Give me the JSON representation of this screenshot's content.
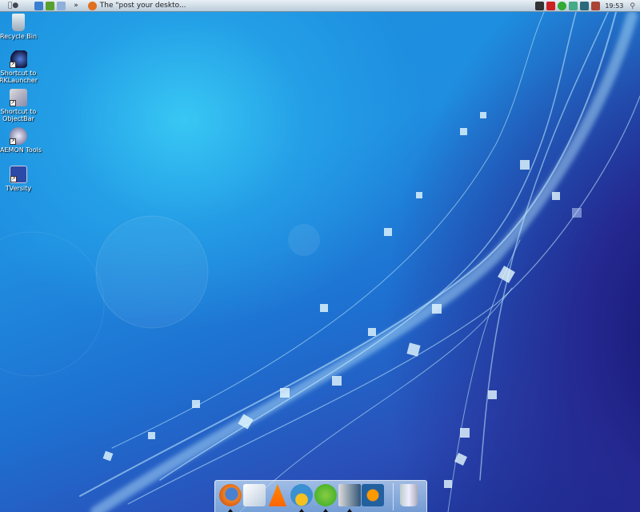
{
  "menubar": {
    "apple_icon": "apple-icon",
    "overflow": "»",
    "active_window": "The \"post your deskto..."
  },
  "tray": {
    "clock": "19:53"
  },
  "desktop_icons": [
    {
      "label": "Recycle Bin",
      "icon": "recycle-bin-icon"
    },
    {
      "label": "Shortcut to RKLauncher",
      "icon": "rklauncher-icon"
    },
    {
      "label": "Shortcut to ObjectBar",
      "icon": "objectbar-icon"
    },
    {
      "label": "DAEMON Tools",
      "icon": "daemon-tools-icon"
    },
    {
      "label": "TVersity",
      "icon": "tversity-icon"
    }
  ],
  "dock": {
    "items": [
      "Firefox",
      "Writer",
      "VLC",
      "Messenger",
      "uTorrent",
      "Media Center",
      "Windows Media Player",
      "Trash"
    ]
  },
  "colors": {
    "accent": "#1f8ee0"
  }
}
